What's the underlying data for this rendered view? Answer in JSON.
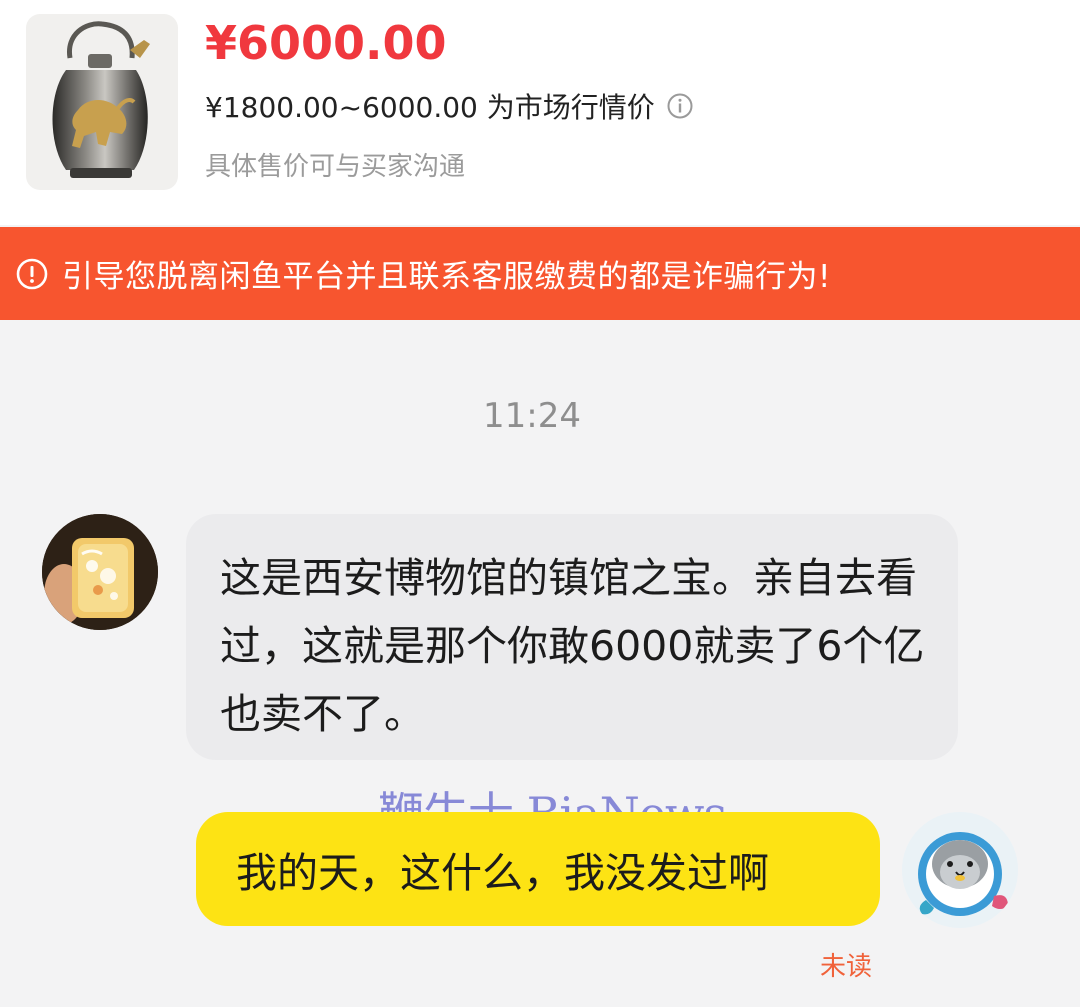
{
  "product": {
    "price": "¥6000.00",
    "price_range": "¥1800.00~6000.00 为市场行情价",
    "price_note": "具体售价可与买家沟通",
    "thumbnail_icon": "bronze-pot-icon",
    "price_color": "#f0383e"
  },
  "warning": {
    "text": "引导您脱离闲鱼平台并且联系客服缴费的都是诈骗行为!",
    "icon": "alert-circle-icon",
    "background": "#f7552f"
  },
  "chat": {
    "timestamp": "11:24",
    "messages": [
      {
        "side": "left",
        "text": "这是西安博物馆的镇馆之宝。亲自去看过，这就是那个你敢6000就卖了6个亿也卖不了。",
        "avatar_icon": "jade-pendant-avatar"
      },
      {
        "side": "right",
        "text": "我的天，这什么，我没发过啊",
        "avatar_icon": "seal-astronaut-avatar",
        "status": "未读"
      }
    ],
    "bubble_self_color": "#fde314",
    "bubble_other_color": "#ebebed"
  },
  "watermark": {
    "text": "鞭牛士 BiaNews"
  }
}
